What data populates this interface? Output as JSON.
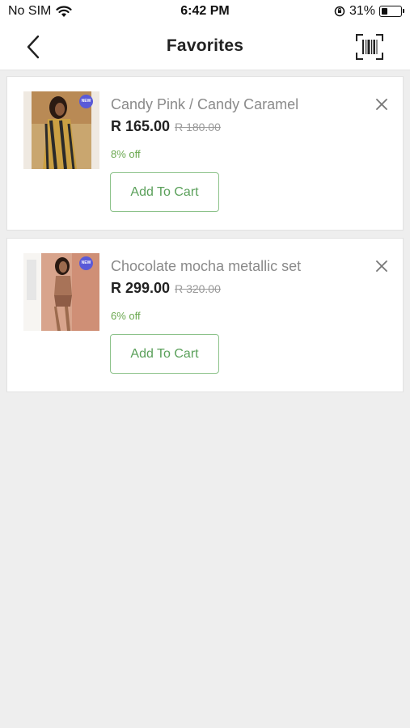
{
  "status_bar": {
    "carrier": "No SIM",
    "time": "6:42 PM",
    "battery_percent": "31%",
    "battery_level": 0.31,
    "icons": [
      "wifi-icon",
      "orientation-lock-icon",
      "battery-icon"
    ]
  },
  "nav": {
    "title": "Favorites",
    "back_icon": "chevron-left-icon",
    "scan_icon": "barcode-scan-icon"
  },
  "favorites": [
    {
      "name": "Candy Pink / Candy Caramel",
      "price": "R 165.00",
      "old_price": "R 180.00",
      "discount": "8% off",
      "cart_label": "Add To Cart",
      "badge": "NEW"
    },
    {
      "name": "Chocolate mocha metallic set",
      "price": "R 299.00",
      "old_price": "R 320.00",
      "discount": "6% off",
      "cart_label": "Add To Cart",
      "badge": "NEW"
    }
  ],
  "colors": {
    "accent_green": "#5aa05a",
    "discount_green": "#6aa84f",
    "background": "#eeeeee"
  }
}
